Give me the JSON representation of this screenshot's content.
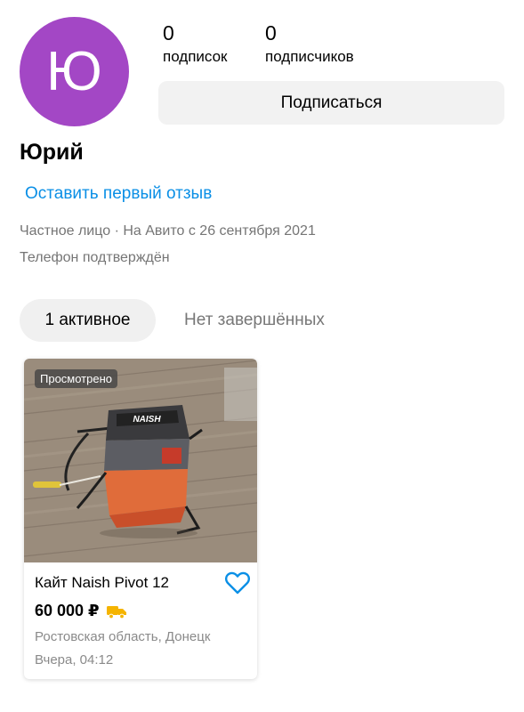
{
  "profile": {
    "avatar_letter": "Ю",
    "avatar_color": "#a347c5",
    "name": "Юрий",
    "stats": [
      {
        "count": "0",
        "label": "подписок"
      },
      {
        "count": "0",
        "label": "подписчиков"
      }
    ],
    "subscribe_label": "Подписаться",
    "review_link": "Оставить первый отзыв",
    "meta_line": "Частное лицо · На Авито с 26 сентября 2021",
    "phone_status": "Телефон подтверждён"
  },
  "tabs": [
    {
      "label": "1 активное",
      "active": true
    },
    {
      "label": "Нет завершённых",
      "active": false
    }
  ],
  "listings": [
    {
      "badge": "Просмотрено",
      "title": "Кайт Naish Pivot 12",
      "price": "60 000 ₽",
      "location": "Ростовская область, Донецк",
      "date": "Вчера, 04:12",
      "bag_label": "NAISH",
      "delivery_icon": "truck-icon",
      "favorite_icon": "heart-icon"
    }
  ],
  "colors": {
    "link": "#0a8fe6",
    "delivery": "#f5b400",
    "favorite": "#0a8fe6"
  }
}
